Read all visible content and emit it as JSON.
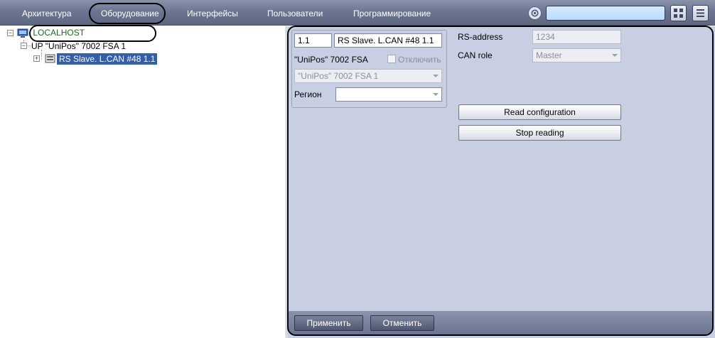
{
  "topbar": {
    "tabs": [
      {
        "label": "Архитектура"
      },
      {
        "label": "Оборудование"
      },
      {
        "label": "Интерфейсы"
      },
      {
        "label": "Пользователи"
      },
      {
        "label": "Программирование"
      }
    ],
    "active_tab": "Оборудование",
    "search": {
      "value": ""
    },
    "icons": [
      "gear-icon",
      "layout-grid-icon",
      "menu-list-icon"
    ]
  },
  "tree": {
    "root": {
      "label": "LOCALHOST",
      "icon": "computer-icon"
    },
    "child": {
      "label": "UP \"UniPos\" 7002 FSA 1"
    },
    "selected": {
      "label": "RS Slave. L.CAN #48 1.1",
      "icon": "device-icon"
    }
  },
  "object": {
    "id": "1.1",
    "name": "RS Slave. L.CAN #48 1.1",
    "parent_type": "\"UniPos\" 7002 FSA",
    "disable_label": "Отключить",
    "parent_value": "\"UniPos\" 7002 FSA 1",
    "region_label": "Регион",
    "region_value": ""
  },
  "settings": {
    "rs_address_label": "RS-address",
    "rs_address_value": "1234",
    "can_role_label": "CAN role",
    "can_role_value": "Master",
    "read_config_label": "Read configuration",
    "stop_reading_label": "Stop reading"
  },
  "footer": {
    "apply_label": "Применить",
    "cancel_label": "Отменить"
  }
}
